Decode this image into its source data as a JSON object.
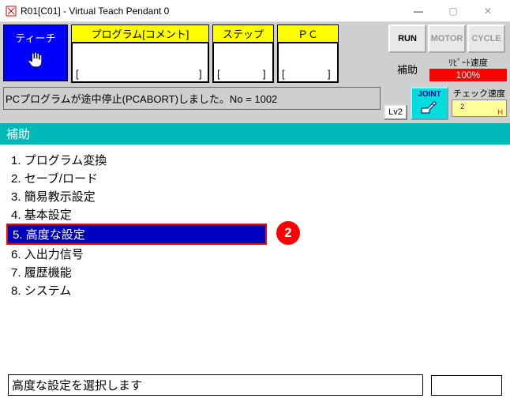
{
  "window": {
    "title": "R01[C01] - Virtual Teach Pendant 0"
  },
  "toolbar": {
    "teach": "ティーチ",
    "program_label": "プログラム[コメント]",
    "step_label": "ステップ",
    "pc_label": "ＰＣ",
    "run": "RUN",
    "motor": "MOTOR",
    "cycle": "CYCLE",
    "aux": "補助",
    "repeat_speed_label": "ﾘﾋﾟｰﾄ速度",
    "repeat_speed_value": "100%"
  },
  "status": {
    "message": "PCプログラムが途中停止(PCABORT)しました。No = 1002",
    "lv": "Lv2",
    "joint": "JOINT",
    "check_speed_label": "チェック速度",
    "check_speed_value": "2"
  },
  "menu": {
    "header": "補助",
    "items": [
      {
        "num": "1.",
        "label": "プログラム変換"
      },
      {
        "num": "2.",
        "label": "セーブ/ロード"
      },
      {
        "num": "3.",
        "label": "簡易教示設定"
      },
      {
        "num": "4.",
        "label": "基本設定"
      },
      {
        "num": "5.",
        "label": "高度な設定"
      },
      {
        "num": "6.",
        "label": "入出力信号"
      },
      {
        "num": "7.",
        "label": "履歴機能"
      },
      {
        "num": "8.",
        "label": "システム"
      }
    ],
    "selected_index": 4,
    "callout": "2"
  },
  "footer": {
    "prompt": "高度な設定を選択します",
    "input": ""
  }
}
